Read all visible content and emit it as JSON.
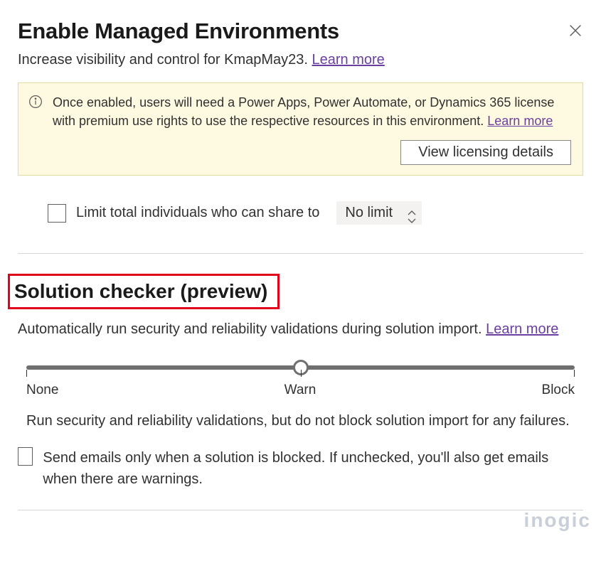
{
  "header": {
    "title": "Enable Managed Environments",
    "subtitle_prefix": "Increase visibility and control for KmapMay23. ",
    "learn_more": "Learn more"
  },
  "banner": {
    "text": "Once enabled, users will need a Power Apps, Power Automate, or Dynamics 365 license with premium use rights to use the respective resources in this environment. ",
    "learn_more": "Learn more",
    "button_label": "View licensing details"
  },
  "limit": {
    "label": "Limit total individuals who can share to",
    "value": "No limit"
  },
  "solution": {
    "heading": "Solution checker (preview)",
    "description_prefix": "Automatically run security and reliability validations during solution import. ",
    "learn_more": "Learn more",
    "slider": {
      "labels": [
        "None",
        "Warn",
        "Block"
      ]
    },
    "help_text": "Run security and reliability validations, but do not block solution import for any failures.",
    "email_checkbox_label": "Send emails only when a solution is blocked. If unchecked, you'll also get emails when there are warnings."
  },
  "watermark": "inogic",
  "colors": {
    "link": "#6b3fa0",
    "highlight_border": "#e1021b",
    "banner_bg": "#fef9e1"
  }
}
